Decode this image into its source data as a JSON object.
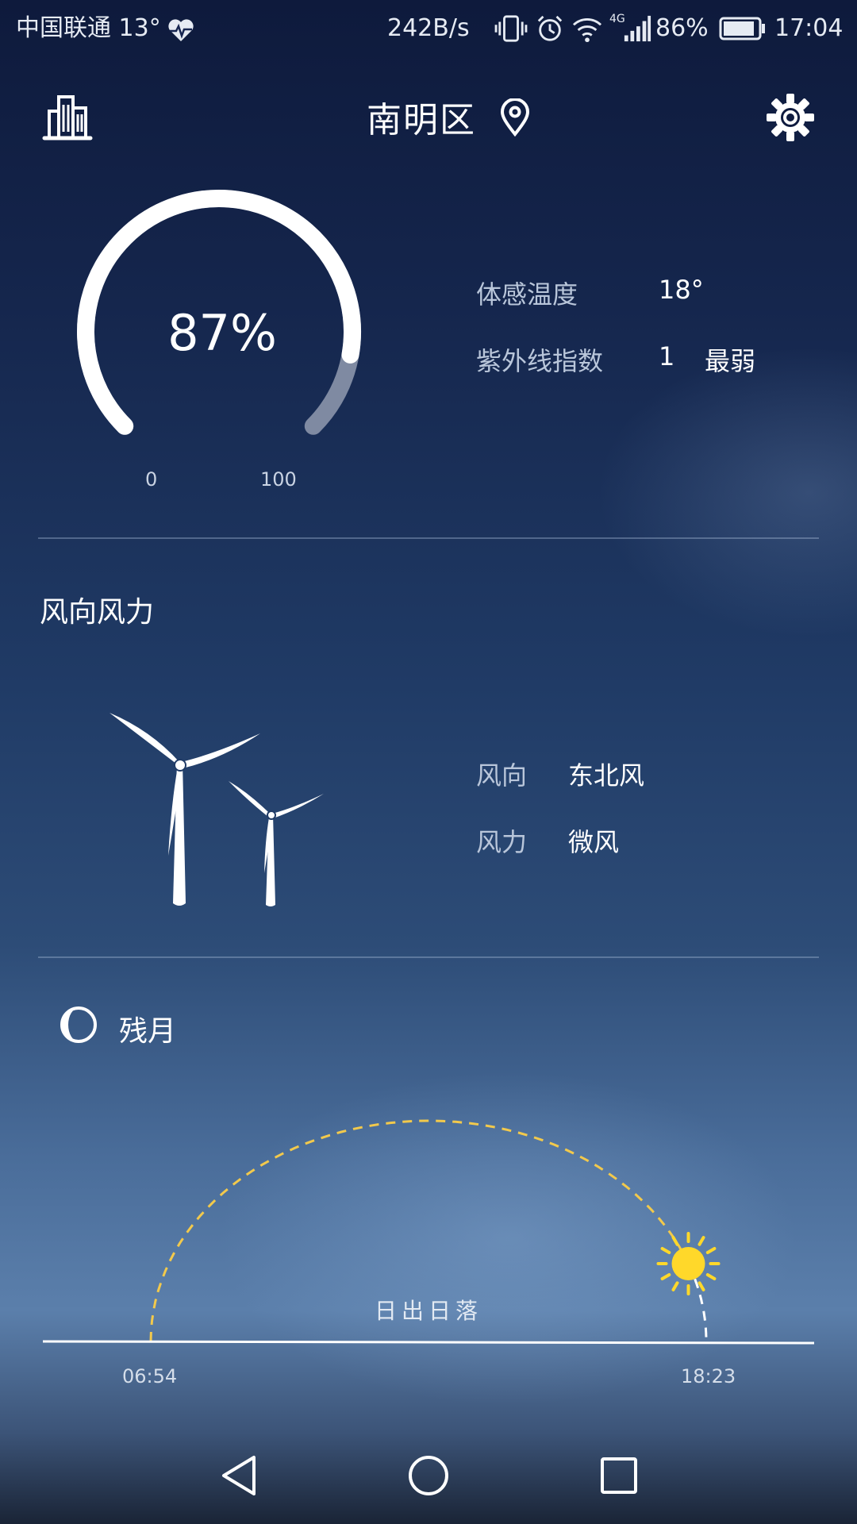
{
  "status_bar": {
    "carrier": "中国联通 13°",
    "net_speed": "242B/s",
    "network_type": "4G",
    "battery": "86%",
    "time": "17:04"
  },
  "header": {
    "location": "南明区",
    "left_icon": "city-buildings-icon",
    "right_icon": "gear-icon"
  },
  "humidity": {
    "value_text": "87%",
    "value": 87,
    "min": "0",
    "max": "100"
  },
  "feels_like": {
    "label": "体感温度",
    "value": "18°"
  },
  "uv": {
    "label": "紫外线指数",
    "value": "1",
    "level": "最弱"
  },
  "wind": {
    "section_title": "风向风力",
    "direction_label": "风向",
    "direction_value": "东北风",
    "force_label": "风力",
    "force_value": "微风"
  },
  "moon": {
    "phase": "残月"
  },
  "sun": {
    "label": "日出日落",
    "sunrise": "06:54",
    "sunset": "18:23",
    "sun_color": "#ffd82a",
    "arc_color": "#f2c94c"
  },
  "navigation": {
    "back_icon": "back-triangle-icon",
    "home_icon": "home-circle-icon",
    "recents_icon": "recents-square-icon"
  }
}
